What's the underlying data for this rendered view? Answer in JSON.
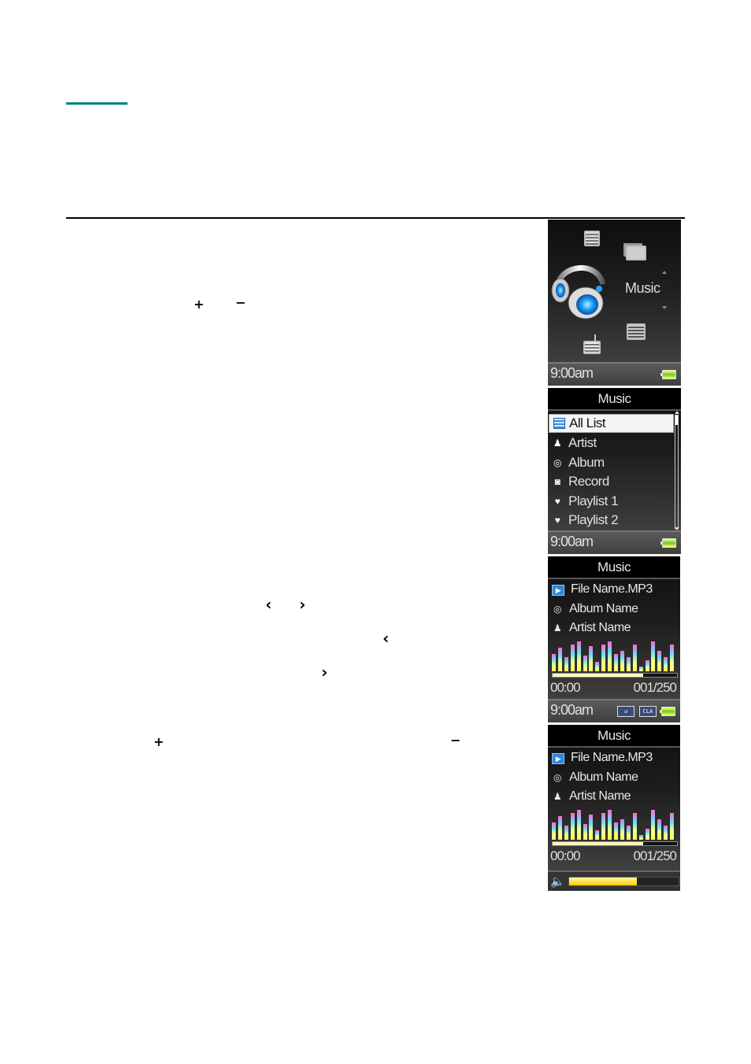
{
  "page": {
    "glyphs": {
      "plus_1": "+",
      "minus_1": "−",
      "prev_1": "‹",
      "next_1": "›",
      "prev_2": "‹",
      "next_2": "›",
      "plus_2": "+",
      "minus_2": "−"
    },
    "colors": {
      "accent_rule": "#008080"
    }
  },
  "screens": {
    "main_menu": {
      "selected_label": "Music",
      "icons": [
        "list-icon",
        "photo-icon",
        "video-icon",
        "radio-icon",
        "headphones-icon"
      ],
      "status": {
        "time": "9:00am",
        "battery": "battery-full-icon"
      }
    },
    "music_list": {
      "title": "Music",
      "items": [
        {
          "label": "All List",
          "icon": "list-icon",
          "glyph": "",
          "selected": true
        },
        {
          "label": "Artist",
          "icon": "person-icon",
          "glyph": "♟"
        },
        {
          "label": "Album",
          "icon": "disc-icon",
          "glyph": "◎"
        },
        {
          "label": "Record",
          "icon": "record-icon",
          "glyph": "◙"
        },
        {
          "label": "Playlist 1",
          "icon": "heart-icon",
          "glyph": "♥"
        },
        {
          "label": "Playlist 2",
          "icon": "heart-icon",
          "glyph": "♥"
        }
      ],
      "status": {
        "time": "9:00am"
      }
    },
    "now_playing": {
      "title": "Music",
      "file_name": "File Name.MP3",
      "album_name": "Album Name",
      "artist_name": "Artist Name",
      "play_glyph": "▶",
      "album_glyph": "◎",
      "artist_glyph": "♟",
      "elapsed": "00:00",
      "track_counter": "001/250",
      "progress": 0.73,
      "equalizer_levels": [
        0.55,
        0.75,
        0.45,
        0.85,
        0.95,
        0.5,
        0.8,
        0.3,
        0.85,
        0.95,
        0.55,
        0.65,
        0.45,
        0.85,
        0.15,
        0.35,
        0.95,
        0.65,
        0.45,
        0.85
      ],
      "status": {
        "time": "9:00am",
        "repeat_label": "↺",
        "eq_label": "CLA"
      }
    },
    "volume": {
      "title": "Music",
      "file_name": "File Name.MP3",
      "album_name": "Album Name",
      "artist_name": "Artist Name",
      "elapsed": "00:00",
      "track_counter": "001/250",
      "progress": 0.73,
      "volume_level": 0.62,
      "volume_glyph": "🔈"
    }
  }
}
